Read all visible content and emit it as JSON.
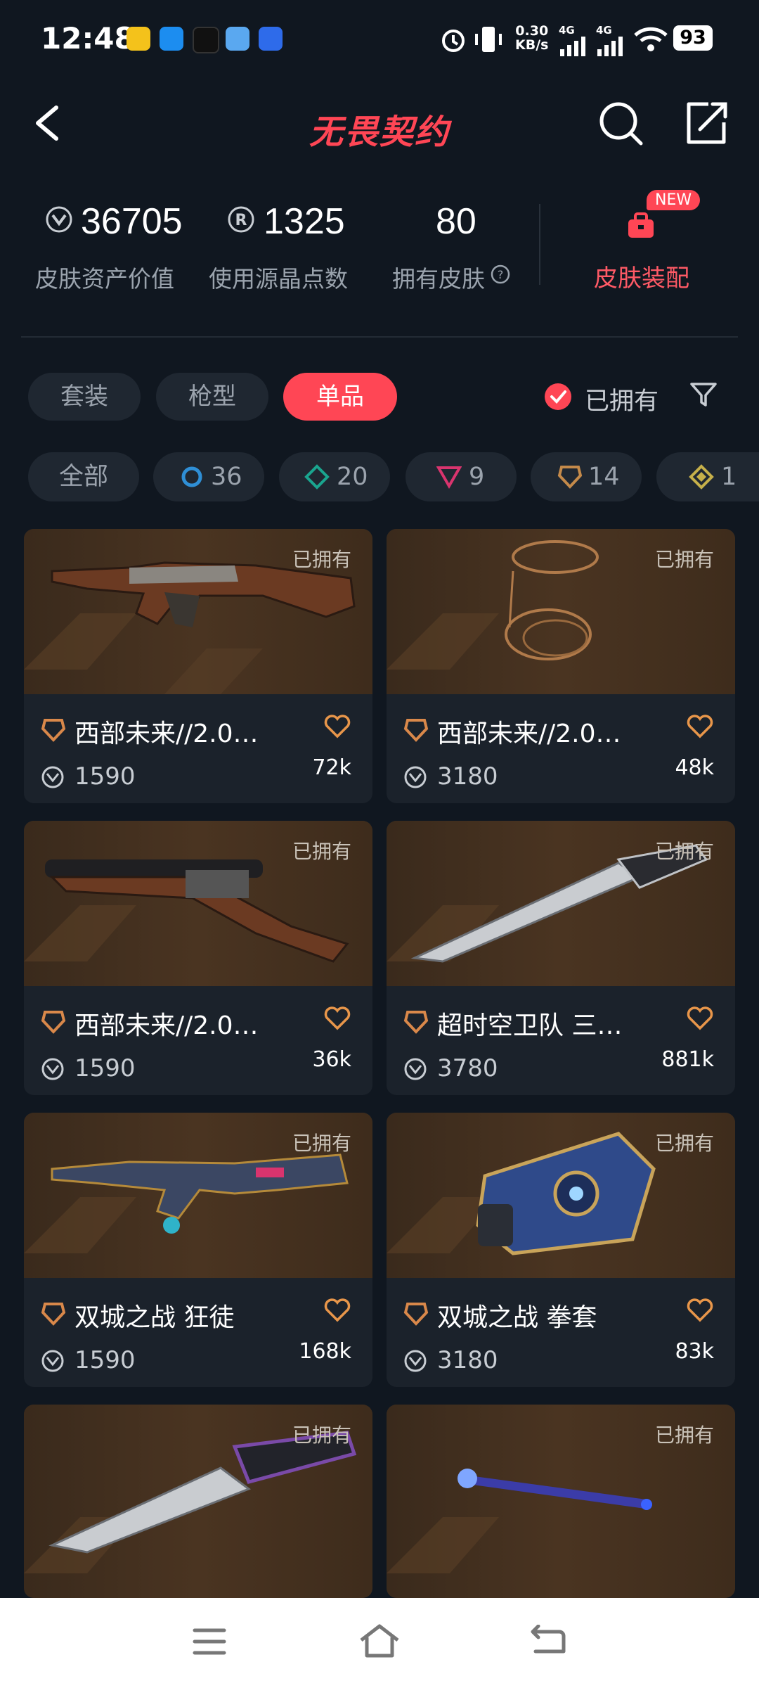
{
  "status_bar": {
    "time": "12:48",
    "net_speed": "0.30",
    "net_unit": "KB/s",
    "sig1": "4G",
    "sig2": "4G",
    "battery": "93"
  },
  "header": {
    "title": "无畏契约"
  },
  "stats": [
    {
      "value": "36705",
      "label": "皮肤资产价值",
      "icon": "vp-coin-icon"
    },
    {
      "value": "1325",
      "label": "使用源晶点数",
      "icon": "radianite-icon"
    },
    {
      "value": "80",
      "label": "拥有皮肤",
      "icon": "help-icon"
    }
  ],
  "loadout": {
    "label": "皮肤装配",
    "badge": "NEW"
  },
  "type_tabs": [
    {
      "label": "套装",
      "active": false
    },
    {
      "label": "枪型",
      "active": false
    },
    {
      "label": "单品",
      "active": true
    }
  ],
  "owned_filter": {
    "label": "已拥有",
    "checked": true
  },
  "rarity_chips": [
    {
      "label": "全部"
    },
    {
      "count": "36",
      "color": "#2f8fd6"
    },
    {
      "count": "20",
      "color": "#1aa58f"
    },
    {
      "count": "9",
      "color": "#d9346e"
    },
    {
      "count": "14",
      "color": "#c48a4a"
    },
    {
      "count": "1",
      "color": "#c6b04a"
    }
  ],
  "cards": [
    {
      "owned": "已拥有",
      "name": "西部未来//2.0…",
      "price": "1590",
      "likes": "72k"
    },
    {
      "owned": "已拥有",
      "name": "西部未来//2.0…",
      "price": "3180",
      "likes": "48k"
    },
    {
      "owned": "已拥有",
      "name": "西部未来//2.0…",
      "price": "1590",
      "likes": "36k"
    },
    {
      "owned": "已拥有",
      "name": "超时空卫队 三…",
      "price": "3780",
      "likes": "881k"
    },
    {
      "owned": "已拥有",
      "name": "双城之战 狂徒",
      "price": "1590",
      "likes": "168k"
    },
    {
      "owned": "已拥有",
      "name": "双城之战 拳套",
      "price": "3180",
      "likes": "83k"
    },
    {
      "owned": "已拥有"
    },
    {
      "owned": "已拥有"
    }
  ]
}
